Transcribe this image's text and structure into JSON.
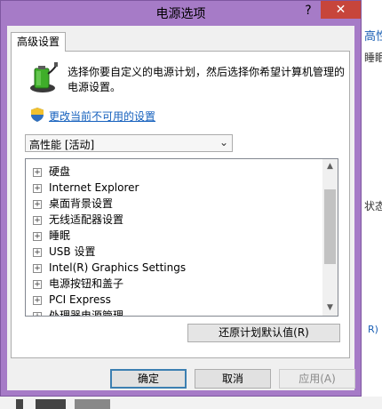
{
  "window": {
    "title": "电源选项",
    "help_glyph": "?",
    "close_glyph": "✕"
  },
  "tab": {
    "label": "高级设置"
  },
  "description": "选择你要自定义的电源计划，然后选择你希望计算机管理的电源设置。",
  "change_link": "更改当前不可用的设置",
  "plan_select": {
    "value": "高性能 [活动]"
  },
  "tree_items": [
    "硬盘",
    "Internet Explorer",
    "桌面背景设置",
    "无线适配器设置",
    "睡眠",
    "USB 设置",
    "Intel(R) Graphics Settings",
    "电源按钮和盖子",
    "PCI Express",
    "处理器电源管理"
  ],
  "restore_button": "还原计划默认值(R)",
  "buttons": {
    "ok": "确定",
    "cancel": "取消",
    "apply": "应用(A)"
  },
  "background_window": {
    "text1": "高性",
    "text2": "睡眠",
    "text3": "状态",
    "text4": "R)"
  },
  "colors": {
    "frame": "#a67bc7",
    "close": "#c7453b",
    "link": "#1560bd",
    "ok_border": "#3c7fb1"
  }
}
